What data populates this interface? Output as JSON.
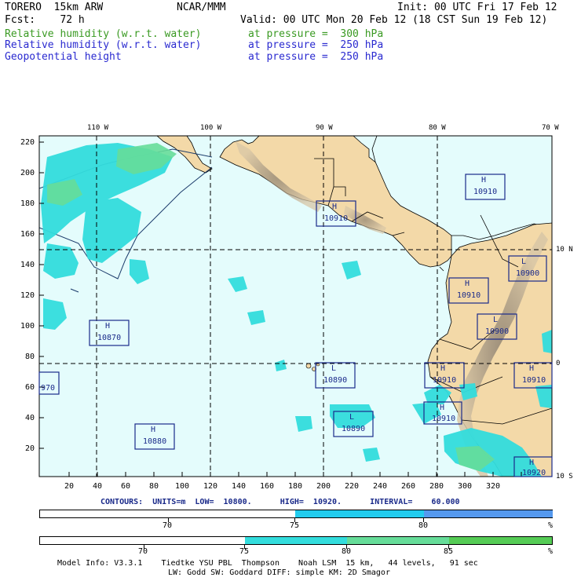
{
  "header": {
    "model": "TORERO  15km ARW",
    "org": "NCAR/MMM",
    "init": "Init: 00 UTC Fri 17 Feb 12",
    "fcst": "Fcst:    72 h",
    "valid": "Valid: 00 UTC Mon 20 Feb 12 (18 CST Sun 19 Feb 12)",
    "fields": [
      {
        "name": "Relative humidity (w.r.t. water)",
        "level": "at pressure =  300 hPa",
        "color": "#3a9a22"
      },
      {
        "name": "Relative humidity (w.r.t. water)",
        "level": "at pressure =  250 hPa",
        "color": "#2a2ad0"
      },
      {
        "name": "Geopotential height",
        "level": "at pressure =  250 hPa",
        "color": "#2a2ad0"
      }
    ]
  },
  "map": {
    "top_lon_labels": [
      "110 W",
      "100 W",
      "90 W",
      "80 W",
      "70 W"
    ],
    "right_lat_labels": [
      "10 N",
      "0",
      "10 S"
    ],
    "left_y_ticks": [
      "220",
      "200",
      "180",
      "160",
      "140",
      "120",
      "100",
      "80",
      "60",
      "40",
      "20"
    ],
    "bottom_x_ticks": [
      "20",
      "40",
      "60",
      "80",
      "100",
      "120",
      "140",
      "160",
      "180",
      "200",
      "220",
      "240",
      "260",
      "280",
      "300",
      "320"
    ],
    "colors": {
      "ocean": "#e4fcfc",
      "land": "#f3d9a8",
      "terrain": "#a89a8a",
      "grid": "#000000",
      "boxes": "#1a2a8a"
    },
    "centers": [
      {
        "type": "H",
        "value": "10910"
      },
      {
        "type": "H",
        "value": "10910"
      },
      {
        "type": "L",
        "value": "10900"
      },
      {
        "type": "H",
        "value": "10910"
      },
      {
        "type": "H",
        "value": "10870"
      },
      {
        "type": "L",
        "value": "10900"
      },
      {
        "type": "",
        "value": "970"
      },
      {
        "type": "L",
        "value": "10890"
      },
      {
        "type": "H",
        "value": "10910"
      },
      {
        "type": "H",
        "value": "10910"
      },
      {
        "type": "H",
        "value": "10910"
      },
      {
        "type": "L",
        "value": "10890"
      },
      {
        "type": "H",
        "value": "10880"
      },
      {
        "type": "H",
        "value": "10920"
      }
    ]
  },
  "contours": "CONTOURS:  UNITS=m  LOW=  10800.      HIGH=  10920.      INTERVAL=    60.000",
  "bar1": {
    "colors": [
      "#ffffff",
      "#22ccee",
      "#5599ee"
    ],
    "labels": [
      "70",
      "75",
      "80"
    ],
    "unit": "%"
  },
  "bar2": {
    "colors": [
      "#ffffff",
      "#33dddd",
      "#66dd99",
      "#55cc55"
    ],
    "labels": [
      "70",
      "75",
      "80",
      "85"
    ],
    "unit": "%"
  },
  "footer": {
    "line1": "Model Info: V3.3.1    Tiedtke YSU PBL  Thompson    Noah LSM  15 km,   44 levels,   91 sec",
    "line2": "LW: Godd SW: Goddard DIFF: simple KM: 2D Smagor"
  }
}
